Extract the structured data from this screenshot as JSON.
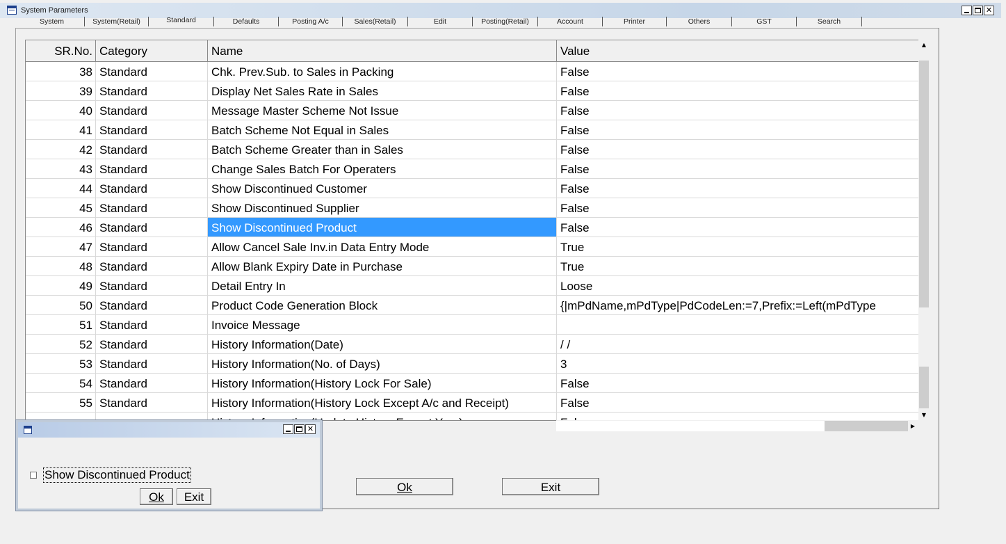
{
  "window": {
    "title": "System Parameters"
  },
  "tabs": [
    "System",
    "System(Retail)",
    "Standard",
    "Defaults",
    "Posting A/c",
    "Sales(Retail)",
    "Edit",
    "Posting(Retail)",
    "Account",
    "Printer",
    "Others",
    "GST",
    "Search"
  ],
  "active_tab": "Standard",
  "grid": {
    "columns": [
      "SR.No.",
      "Category",
      "Name",
      "Value"
    ],
    "rows": [
      {
        "sr": "38",
        "category": "Standard",
        "name": "Chk. Prev.Sub. to Sales in Packing",
        "value": "False"
      },
      {
        "sr": "39",
        "category": "Standard",
        "name": "Display Net Sales Rate in Sales",
        "value": "False"
      },
      {
        "sr": "40",
        "category": "Standard",
        "name": "Message Master Scheme Not Issue",
        "value": "False"
      },
      {
        "sr": "41",
        "category": "Standard",
        "name": "Batch Scheme Not Equal in Sales",
        "value": "False"
      },
      {
        "sr": "42",
        "category": "Standard",
        "name": "Batch Scheme Greater than in Sales",
        "value": "False"
      },
      {
        "sr": "43",
        "category": "Standard",
        "name": "Change Sales Batch For Operaters",
        "value": "False"
      },
      {
        "sr": "44",
        "category": "Standard",
        "name": "Show Discontinued Customer",
        "value": "False"
      },
      {
        "sr": "45",
        "category": "Standard",
        "name": "Show Discontinued Supplier",
        "value": "False"
      },
      {
        "sr": "46",
        "category": "Standard",
        "name": "Show Discontinued Product",
        "value": "False",
        "selected": true
      },
      {
        "sr": "47",
        "category": "Standard",
        "name": "Allow Cancel Sale Inv.in Data Entry Mode",
        "value": "True"
      },
      {
        "sr": "48",
        "category": "Standard",
        "name": "Allow Blank Expiry Date in Purchase",
        "value": "True"
      },
      {
        "sr": "49",
        "category": "Standard",
        "name": "Detail Entry In",
        "value": "Loose"
      },
      {
        "sr": "50",
        "category": "Standard",
        "name": "Product Code Generation Block",
        "value": "{|mPdName,mPdType|PdCodeLen:=7,Prefix:=Left(mPdType"
      },
      {
        "sr": "51",
        "category": "Standard",
        "name": "Invoice Message",
        "value": ""
      },
      {
        "sr": "52",
        "category": "Standard",
        "name": "History Information(Date)",
        "value": "  /  /"
      },
      {
        "sr": "53",
        "category": "Standard",
        "name": "History Information(No. of Days)",
        "value": "3"
      },
      {
        "sr": "54",
        "category": "Standard",
        "name": "History Information(History Lock For Sale)",
        "value": "False"
      },
      {
        "sr": "55",
        "category": "Standard",
        "name": "History Information(History Lock Except A/c and Receipt)",
        "value": "False"
      },
      {
        "sr": "",
        "category": "",
        "name": "History Information(Update History Except Year)",
        "value": "False"
      }
    ],
    "selection_color": "#3399ff"
  },
  "buttons": {
    "ok": "Ok",
    "exit": "Exit"
  },
  "dialog": {
    "checkbox_label": "Show Discontinued Product",
    "checked": false,
    "ok": "Ok",
    "exit": "Exit"
  }
}
